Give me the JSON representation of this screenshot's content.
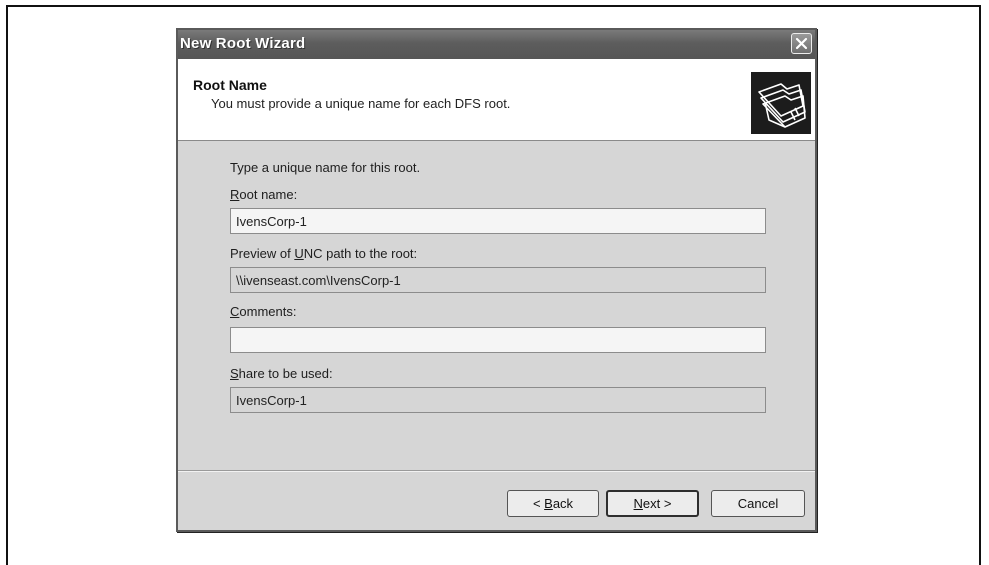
{
  "window": {
    "title": "New Root Wizard"
  },
  "header": {
    "title": "Root Name",
    "subtitle": "You must provide a unique name for each DFS root.",
    "icon": "folders-icon"
  },
  "form": {
    "instruction": "Type a unique name for this root.",
    "root_name": {
      "label_mnemonic": "R",
      "label_rest": "oot name:",
      "value": "IvensCorp-1"
    },
    "unc_preview": {
      "label_before": "Preview of ",
      "label_mnemonic": "U",
      "label_after": "NC path to the root:",
      "value": "\\\\ivenseast.com\\IvensCorp-1"
    },
    "comments": {
      "label_mnemonic": "C",
      "label_rest": "omments:",
      "value": ""
    },
    "share": {
      "label_mnemonic": "S",
      "label_rest": "hare to be used:",
      "value": "IvensCorp-1"
    }
  },
  "buttons": {
    "back_prefix": "< ",
    "back_mnemonic": "B",
    "back_rest": "ack",
    "next_mnemonic": "N",
    "next_rest": "ext >",
    "cancel": "Cancel"
  }
}
